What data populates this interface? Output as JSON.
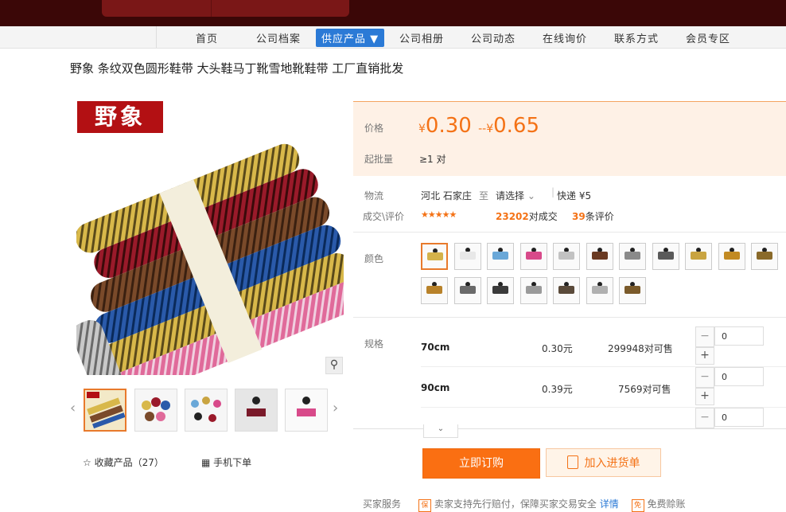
{
  "nav": {
    "items": [
      "首页",
      "公司档案",
      "供应产品 ▼",
      "公司相册",
      "公司动态",
      "在线询价",
      "联系方式",
      "会员专区"
    ],
    "active_index": 2
  },
  "product": {
    "title": "野象 条纹双色圆形鞋带 大头鞋马丁靴雪地靴鞋带 工厂直销批发",
    "brand_badge": "野象",
    "favorite_label": "收藏产品（27）",
    "mobile_label": "手机下单"
  },
  "price": {
    "label": "价格",
    "yen": "¥",
    "low": "0.30",
    "sep": "--",
    "high": "0.65",
    "moq_label": "起批量",
    "moq_value": "≥1 对"
  },
  "logistics": {
    "label": "物流",
    "from": "河北 石家庄",
    "to_word": "至",
    "select": "请选择",
    "express": "快递 ¥5",
    "deals_label": "成交\\评价",
    "stars": "★★★★★",
    "deals_count": "23202",
    "deals_suffix": "对成交",
    "reviews_count": "39",
    "reviews_suffix": "条评价"
  },
  "colors": {
    "label": "颜色",
    "swatch_colors": [
      "#d4b24a",
      "#e8e8e8",
      "#6aa8d8",
      "#d84a8a",
      "#c2c2c2",
      "#6a3a22",
      "#8a8a8a",
      "#5a5a5a",
      "#c9a441",
      "#c28a22",
      "#8a6a2a",
      "#b8822a",
      "#6a6a6a",
      "#3a3a3a",
      "#9a9a9a",
      "#5a4a3a",
      "#b0b0b0",
      "#7a5a2a"
    ]
  },
  "specs": {
    "label": "规格",
    "rows": [
      {
        "name": "70cm",
        "price": "0.30元",
        "stock": "299948对可售",
        "qty": "0"
      },
      {
        "name": "90cm",
        "price": "0.39元",
        "stock": "7569对可售",
        "qty": "0"
      },
      {
        "qty": "0"
      }
    ],
    "expand_icon": "⌄"
  },
  "actions": {
    "order": "立即订购",
    "cart": "加入进货单",
    "cart_icon": "list-icon"
  },
  "service": {
    "label": "买家服务",
    "tag1": "保",
    "text1": "卖家支持先行赔付，保障买家交易安全",
    "link1": "详情",
    "tag2": "免",
    "text2": "免费赊账"
  },
  "thumbs": {
    "count": 5
  }
}
